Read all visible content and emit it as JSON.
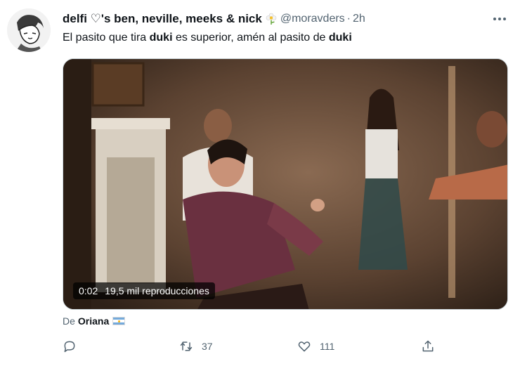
{
  "tweet": {
    "display_name": "delfi ♡'s ben, neville, meeks & nick",
    "handle": "@moravders",
    "separator": "·",
    "time": "2h",
    "text_parts": {
      "p1": "El pasito que tira ",
      "b1": "duki",
      "p2": " es superior, amén al pasito de ",
      "b2": "duki"
    }
  },
  "media": {
    "video_time": "0:02",
    "views": "19,5 mil reproducciones"
  },
  "attribution": {
    "prefix": "De",
    "name": "Oriana"
  },
  "actions": {
    "reply_icon": "reply-icon",
    "retweet_icon": "retweet-icon",
    "retweet_count": "37",
    "like_icon": "heart-icon",
    "like_count": "111",
    "share_icon": "share-icon"
  },
  "colors": {
    "text_primary": "#0f1419",
    "text_secondary": "#536471"
  }
}
